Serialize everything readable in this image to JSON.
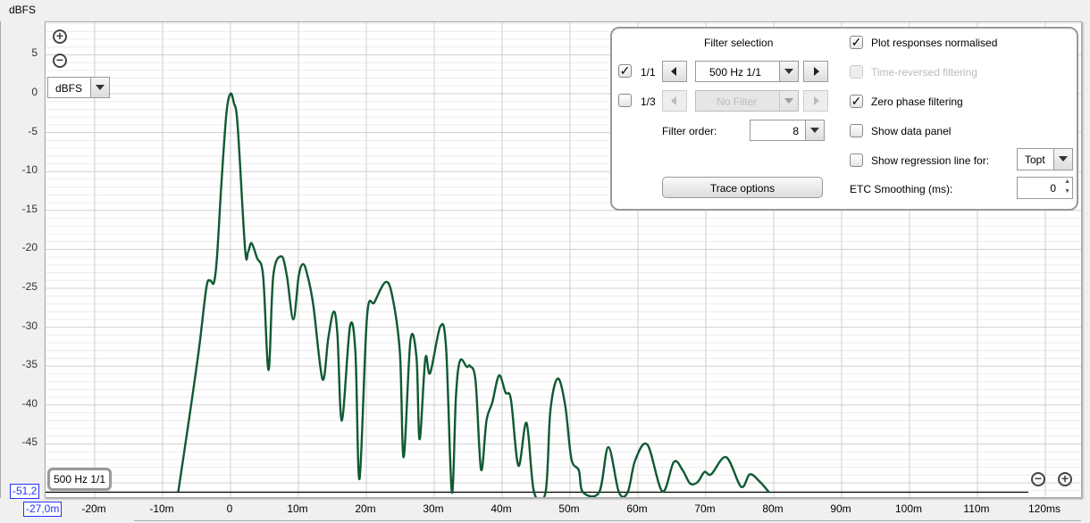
{
  "y_unit_label": "dBFS",
  "unit_select": {
    "value": "dBFS"
  },
  "readouts": {
    "y": "-51,2",
    "x": "-27,0m"
  },
  "trace_tag": "500 Hz 1/1",
  "panel": {
    "filter_selection_title": "Filter selection",
    "row1": {
      "checked": true,
      "label": "1/1",
      "value": "500 Hz 1/1"
    },
    "row2": {
      "checked": false,
      "label": "1/3",
      "value": "No Filter",
      "disabled": true
    },
    "filter_order_label": "Filter order:",
    "filter_order_value": "8",
    "trace_options": "Trace options",
    "options": [
      {
        "label": "Plot responses normalised",
        "checked": true,
        "disabled": false
      },
      {
        "label": "Time-reversed filtering",
        "checked": false,
        "disabled": true
      },
      {
        "label": "Zero phase filtering",
        "checked": true,
        "disabled": false
      },
      {
        "label": "Show data panel",
        "checked": false,
        "disabled": false
      },
      {
        "label": "Show regression line for:",
        "checked": false,
        "disabled": false
      }
    ],
    "regression_select": "Topt",
    "etc_smoothing_label": "ETC Smoothing (ms):",
    "etc_smoothing_value": "0"
  },
  "chart_data": {
    "type": "line",
    "xlabel": "",
    "ylabel": "dBFS",
    "xlim": [
      -27.2,
      125.3
    ],
    "ylim": [
      -51.2,
      9.2
    ],
    "x_ticks": [
      "-20m",
      "-10m",
      "0",
      "10m",
      "20m",
      "30m",
      "40m",
      "50m",
      "60m",
      "70m",
      "80m",
      "90m",
      "100m",
      "110m",
      "120ms"
    ],
    "x_tick_values": [
      -20,
      -10,
      0,
      10,
      20,
      30,
      40,
      50,
      60,
      70,
      80,
      90,
      100,
      110,
      120
    ],
    "y_ticks": [
      5,
      0,
      -5,
      -10,
      -15,
      -20,
      -25,
      -30,
      -35,
      -40,
      -45,
      -50
    ],
    "grid": true,
    "line_color": "#0f5a32",
    "series": [
      {
        "points": [
          [
            -7.7,
            -51.2
          ],
          [
            -5.75,
            -39.7
          ],
          [
            -4.6,
            -32.5
          ],
          [
            -3.55,
            -24.9
          ],
          [
            -3.0,
            -24.0
          ],
          [
            -2.45,
            -24.3
          ],
          [
            -2.0,
            -21.1
          ],
          [
            -1.35,
            -11.7
          ],
          [
            -0.6,
            -2.5
          ],
          [
            0,
            0
          ],
          [
            0.5,
            -1.2
          ],
          [
            1.05,
            -4.1
          ],
          [
            2.15,
            -20
          ],
          [
            2.6,
            -20.3
          ],
          [
            3.1,
            -19.2
          ],
          [
            3.9,
            -21.1
          ],
          [
            4.8,
            -23.4
          ],
          [
            5.6,
            -35.5
          ],
          [
            6.3,
            -23.4
          ],
          [
            7.5,
            -20.9
          ],
          [
            8.3,
            -23.4
          ],
          [
            9.25,
            -29.0
          ],
          [
            10.05,
            -23.4
          ],
          [
            10.7,
            -21.9
          ],
          [
            11.35,
            -23.4
          ],
          [
            12.2,
            -27.2
          ],
          [
            13.55,
            -36.7
          ],
          [
            14.4,
            -31.4
          ],
          [
            15.2,
            -28.0
          ],
          [
            15.75,
            -31
          ],
          [
            16.4,
            -42
          ],
          [
            17.6,
            -29.9
          ],
          [
            18.4,
            -33.3
          ],
          [
            19.0,
            -49.5
          ],
          [
            20.1,
            -28.7
          ],
          [
            21.2,
            -26.8
          ],
          [
            22.85,
            -24.2
          ],
          [
            23.85,
            -26.1
          ],
          [
            24.95,
            -33.3
          ],
          [
            25.5,
            -46.7
          ],
          [
            26.5,
            -31.7
          ],
          [
            27.4,
            -34
          ],
          [
            27.85,
            -44.4
          ],
          [
            28.7,
            -34
          ],
          [
            29.4,
            -35.9
          ],
          [
            30.9,
            -29.9
          ],
          [
            31.75,
            -32.7
          ],
          [
            32.6,
            -51.2
          ],
          [
            33.2,
            -38.9
          ],
          [
            33.8,
            -34.3
          ],
          [
            34.8,
            -35.1
          ],
          [
            35.3,
            -35
          ],
          [
            36.1,
            -37
          ],
          [
            36.9,
            -48.3
          ],
          [
            37.7,
            -42
          ],
          [
            38.55,
            -39.7
          ],
          [
            39.55,
            -36.2
          ],
          [
            40.5,
            -38.4
          ],
          [
            41.3,
            -39.3
          ],
          [
            42.4,
            -47.8
          ],
          [
            43.6,
            -42.3
          ],
          [
            44.7,
            -51.2
          ],
          [
            46.4,
            -51.2
          ],
          [
            47.1,
            -40.8
          ],
          [
            48.2,
            -36.6
          ],
          [
            49.3,
            -40.1
          ],
          [
            50.2,
            -46.9
          ],
          [
            51.3,
            -48.4
          ],
          [
            51.9,
            -51.2
          ],
          [
            54.3,
            -51.2
          ],
          [
            55.65,
            -45.4
          ],
          [
            57.2,
            -51.2
          ],
          [
            58.5,
            -51.2
          ],
          [
            59.6,
            -47.1
          ],
          [
            61.4,
            -45.1
          ],
          [
            63.6,
            -51.1
          ],
          [
            65.3,
            -47.3
          ],
          [
            66.6,
            -48.4
          ],
          [
            67.7,
            -50.1
          ],
          [
            68.8,
            -49.9
          ],
          [
            69.8,
            -48.6
          ],
          [
            70.8,
            -48.9
          ],
          [
            73,
            -46.7
          ],
          [
            75.2,
            -50.5
          ],
          [
            76.5,
            -48.9
          ],
          [
            78,
            -49.9
          ],
          [
            79.3,
            -51.2
          ]
        ]
      }
    ]
  }
}
